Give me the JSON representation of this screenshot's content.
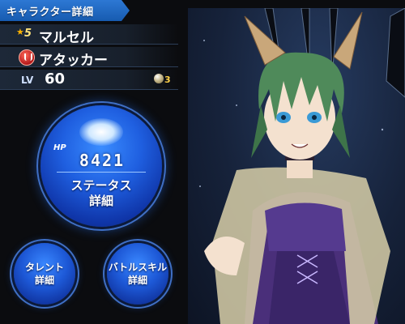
{
  "header": {
    "title": "キャラクター詳細"
  },
  "character": {
    "rarity": "5",
    "name": "マルセル",
    "role": "アタッカー",
    "level_label": "LV",
    "level": "60",
    "limit_count": "3"
  },
  "status_button": {
    "hp_label": "HP",
    "hp_value": "8421",
    "label_line1": "ステータス",
    "label_line2": "詳細"
  },
  "talent_button": {
    "label_line1": "タレント",
    "label_line2": "詳細"
  },
  "skill_button": {
    "label_line1": "バトルスキル",
    "label_line2": "詳細"
  },
  "colors": {
    "accent": "#1f5fe0",
    "header": "#2d78d4",
    "rarity": "#ffcf3a"
  }
}
